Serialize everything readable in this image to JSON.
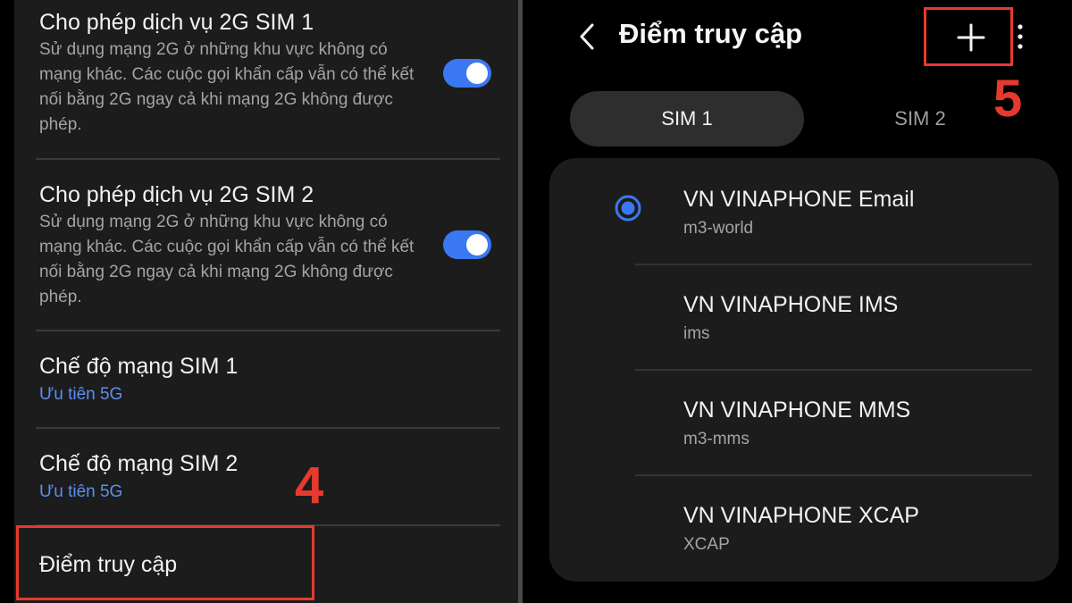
{
  "left": {
    "items": [
      {
        "title": "Cho phép dịch vụ 2G SIM 1",
        "desc": "Sử dụng mạng 2G ở những khu vực không có mạng khác. Các cuộc gọi khẩn cấp vẫn có thể kết nối bằng 2G ngay cả khi mạng 2G không được phép.",
        "toggle": "on"
      },
      {
        "title": "Cho phép dịch vụ 2G SIM 2",
        "desc": "Sử dụng mạng 2G ở những khu vực không có mạng khác. Các cuộc gọi khẩn cấp vẫn có thể kết nối bằng 2G ngay cả khi mạng 2G không được phép.",
        "toggle": "on"
      },
      {
        "title": "Chế độ mạng SIM 1",
        "sub": "Ưu tiên 5G"
      },
      {
        "title": "Chế độ mạng SIM 2",
        "sub": "Ưu tiên 5G"
      },
      {
        "title": "Điểm truy cập"
      }
    ],
    "step_label": "4"
  },
  "right": {
    "title": "Điểm truy cập",
    "step_label": "5",
    "tabs": [
      {
        "label": "SIM 1",
        "selected": true
      },
      {
        "label": "SIM 2",
        "selected": false
      }
    ],
    "apns": [
      {
        "name": "VN VINAPHONE Email",
        "sub": "m3-world",
        "selected": true
      },
      {
        "name": "VN VINAPHONE IMS",
        "sub": "ims",
        "selected": false
      },
      {
        "name": "VN VINAPHONE MMS",
        "sub": "m3-mms",
        "selected": false
      },
      {
        "name": "VN VINAPHONE XCAP",
        "sub": "XCAP",
        "selected": false
      }
    ],
    "icons": [
      "back-icon",
      "plus-icon",
      "more-vertical-icon",
      "radio-selected-icon"
    ]
  },
  "colors": {
    "accent": "#3a78f2",
    "subtitle_link": "#5b8ff0",
    "highlight": "#e63a2e",
    "panel_bg": "#1c1c1c"
  }
}
